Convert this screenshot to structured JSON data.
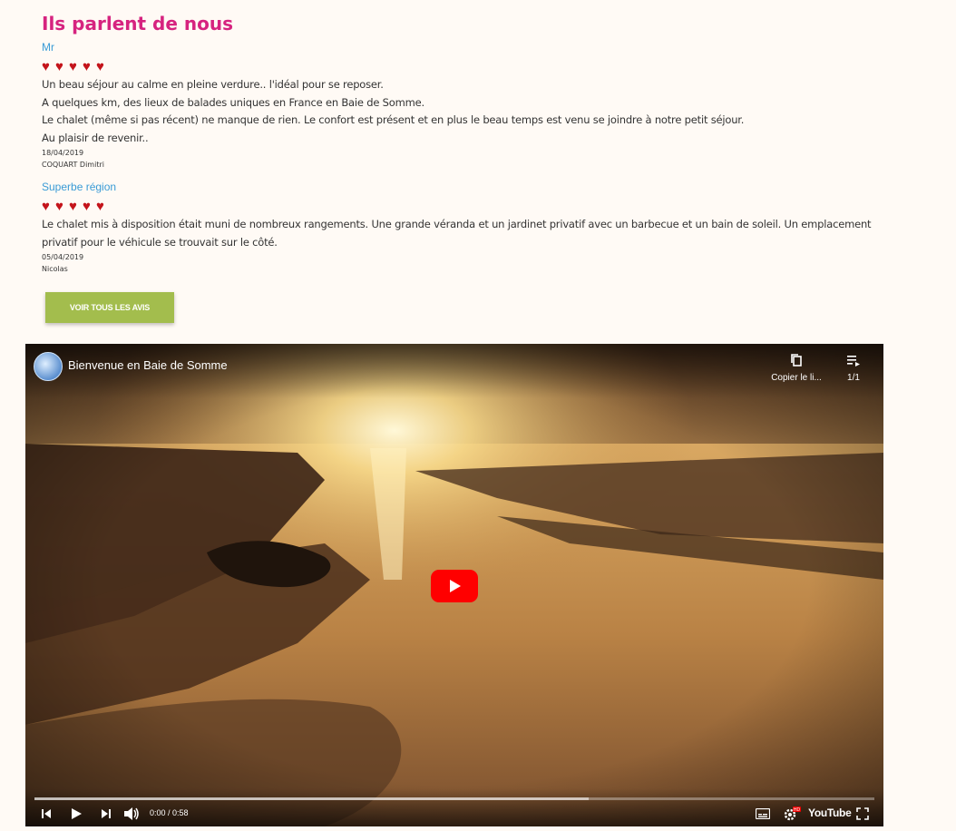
{
  "section": {
    "title": "Ils parlent de nous"
  },
  "reviews": [
    {
      "title": "Mr",
      "rating": 5,
      "lines": [
        "Un beau séjour au calme en pleine verdure.. l'idéal pour se reposer.",
        "A quelques km, des lieux de balades uniques en France en Baie de Somme.",
        "Le chalet (même si pas récent) ne manque de rien. Le confort est présent et en plus le beau temps est venu se joindre à notre petit séjour.",
        "Au plaisir de revenir.."
      ],
      "date": "18/04/2019",
      "author": "COQUART Dimitri"
    },
    {
      "title": "Superbe région",
      "rating": 5,
      "lines": [
        "Le chalet mis à disposition était muni de nombreux rangements. Une grande véranda et un jardinet privatif avec un barbecue et un bain de soleil. Un emplacement",
        "privatif pour le véhicule se trouvait sur le côté."
      ],
      "date": "05/04/2019",
      "author": "Nicolas"
    }
  ],
  "button": {
    "label": "VOIR TOUS LES AVIS"
  },
  "video": {
    "title": "Bienvenue en Baie de Somme",
    "copy_label": "Copier le li...",
    "playlist_label": "1/1",
    "time": "0:00 / 0:58",
    "progress": 0.66,
    "brand": "YouTube",
    "hd_badge": "HD"
  },
  "colors": {
    "heading": "#d6237f",
    "review_title": "#3a9bd6",
    "heart": "#c4141b",
    "button": "#a3bd4d",
    "play": "#ff0000"
  }
}
